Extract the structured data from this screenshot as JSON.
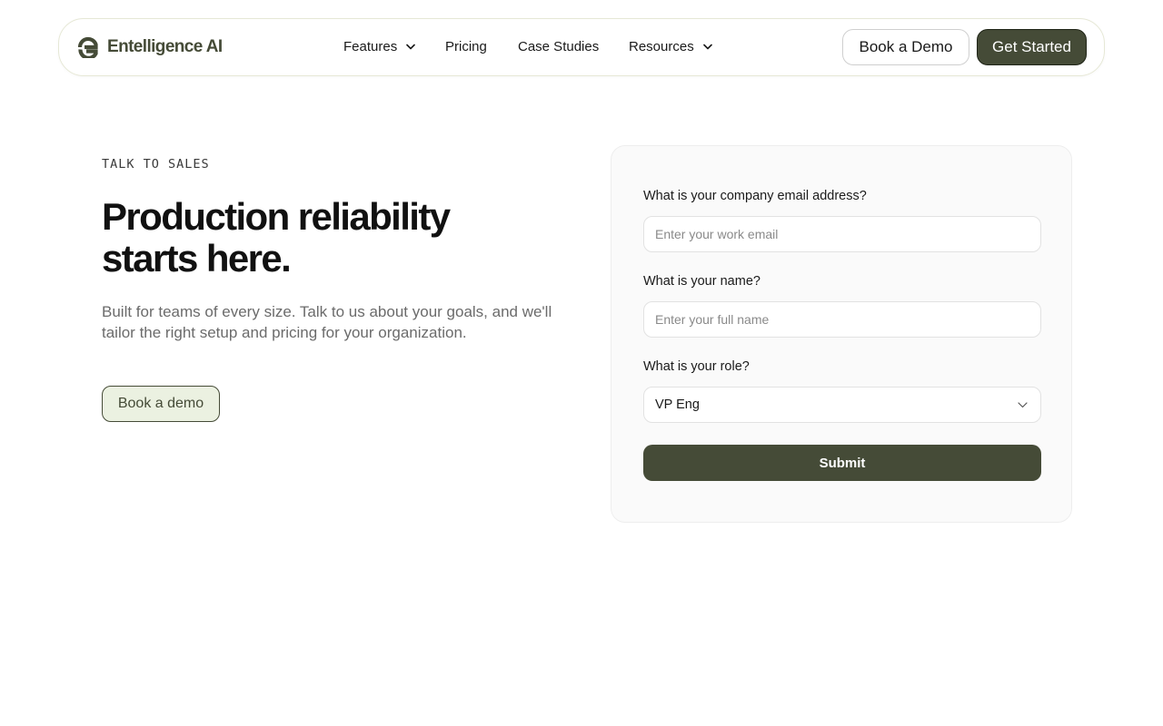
{
  "navbar": {
    "brand": "Entelligence AI",
    "logo_icon": "entelligence-logo-icon",
    "items": [
      {
        "label": "Features",
        "has_dropdown": true
      },
      {
        "label": "Pricing",
        "has_dropdown": false
      },
      {
        "label": "Case Studies",
        "has_dropdown": false
      },
      {
        "label": "Resources",
        "has_dropdown": true
      }
    ],
    "book_demo_label": "Book a Demo",
    "get_started_label": "Get Started"
  },
  "hero": {
    "eyebrow": "TALK TO SALES",
    "headline_line1": "Production reliability",
    "headline_line2": "starts here.",
    "subtext": "Built for teams of every size. Talk to us about your goals, and we'll tailor the right setup and pricing for your organization.",
    "cta_label": "Book a demo"
  },
  "form": {
    "email": {
      "label": "What is your company email address?",
      "placeholder": "Enter your work email",
      "value": ""
    },
    "name": {
      "label": "What is your name?",
      "placeholder": "Enter your full name",
      "value": ""
    },
    "role": {
      "label": "What is your role?",
      "selected": "VP Eng"
    },
    "submit_label": "Submit"
  },
  "colors": {
    "brand_dark": "#454b37",
    "brand_light": "#ebf1e1",
    "card_bg": "#fafafa",
    "muted_text": "#6b6b6b"
  }
}
